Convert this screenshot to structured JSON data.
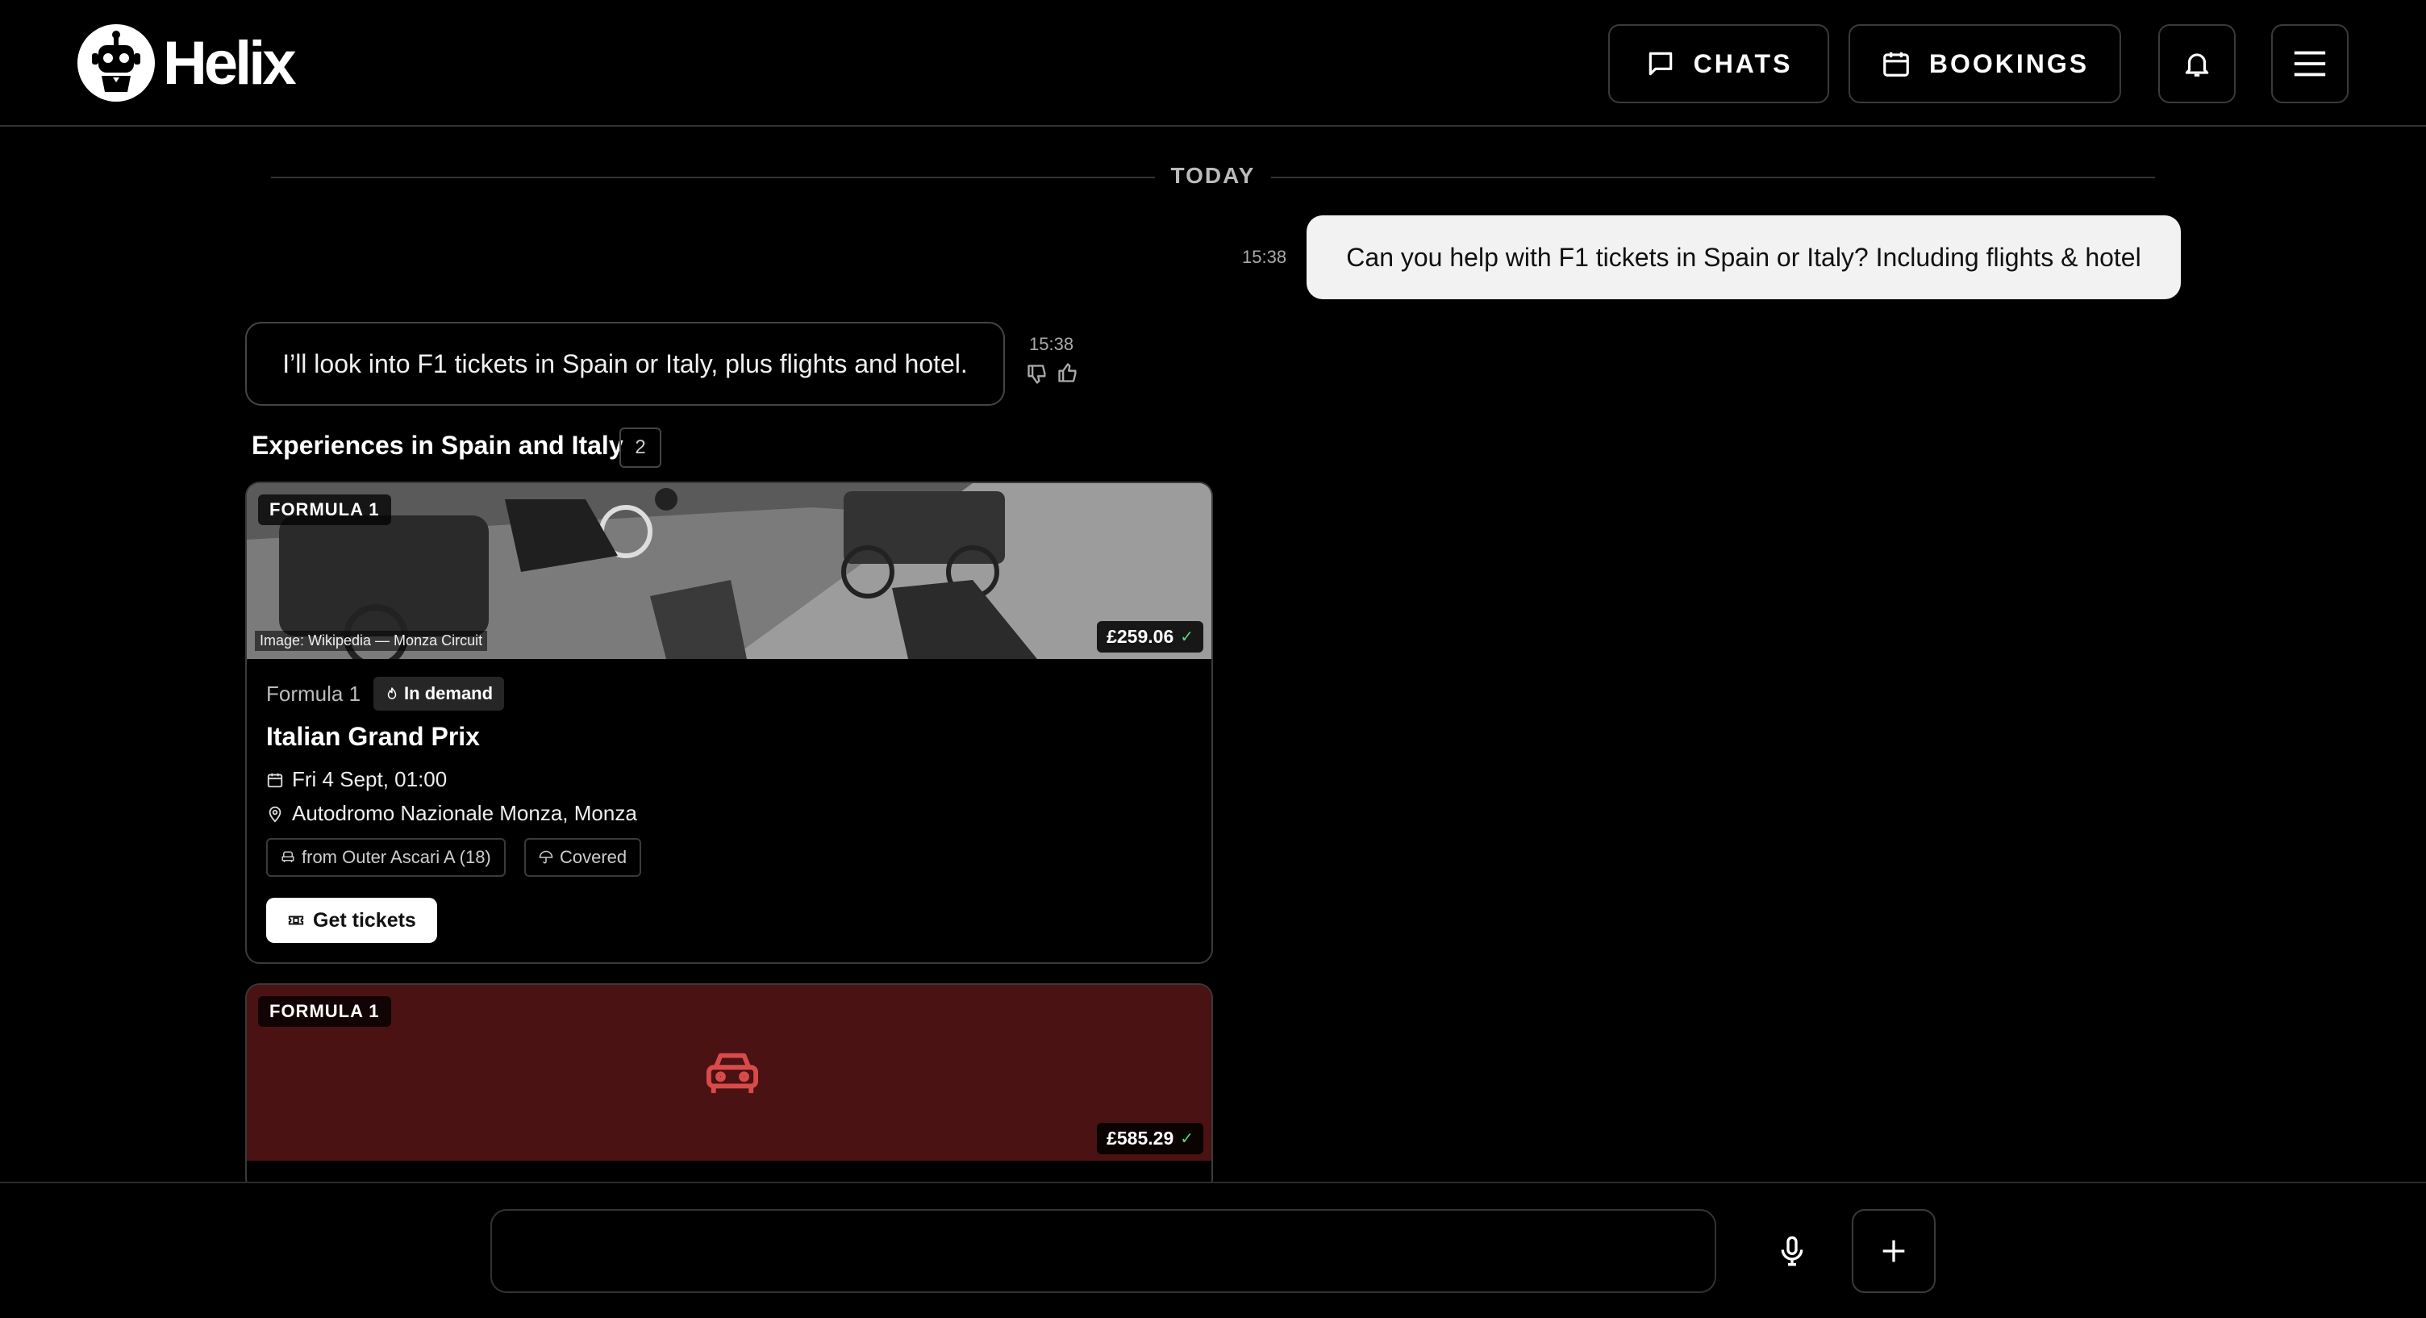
{
  "header": {
    "brand": "Helix",
    "chats_label": "CHATS",
    "bookings_label": "BOOKINGS"
  },
  "conversation": {
    "date_divider": "TODAY",
    "user_message": {
      "text": "Can you help with F1 tickets in Spain or Italy? Including flights & hotel",
      "time": "15:38"
    },
    "bot_message": {
      "text": "I’ll look into F1 tickets in Spain or Italy, plus flights and hotel.",
      "time": "15:38"
    }
  },
  "results": {
    "title": "Experiences in Spain and Italy",
    "count": "2",
    "cards": [
      {
        "tag": "FORMULA 1",
        "image_credit": "Image: Wikipedia — Monza Circuit",
        "price": "£259.06",
        "category": "Formula 1",
        "badge": "In demand",
        "title": "Italian Grand Prix",
        "date": "Fri 4 Sept, 01:00",
        "venue": "Autodromo Nazionale Monza, Monza",
        "chips": [
          "from Outer Ascari A (18)",
          "Covered"
        ],
        "cta": "Get tickets"
      },
      {
        "tag": "FORMULA 1",
        "price": "£585.29",
        "image_icon": "car-icon"
      }
    ]
  },
  "composer": {
    "placeholder": "",
    "mic_icon": "microphone-icon",
    "add_icon": "plus-icon"
  },
  "colors": {
    "background": "#000000",
    "accent_red": "#d94b4b",
    "card2_bg": "#4a1212",
    "check_green": "#5bd47a"
  }
}
